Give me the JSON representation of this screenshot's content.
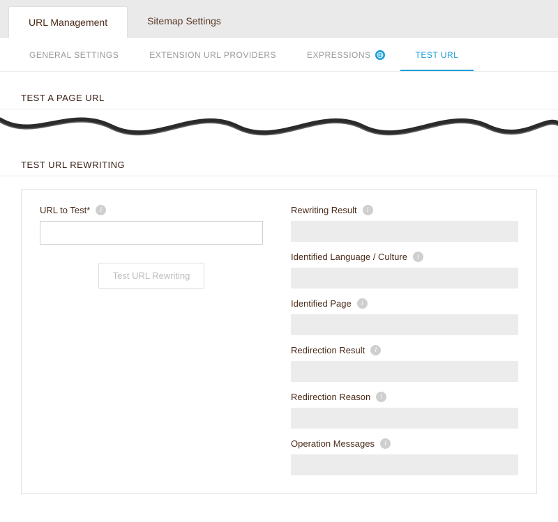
{
  "top_tabs": {
    "url_management": "URL Management",
    "sitemap_settings": "Sitemap Settings"
  },
  "sub_tabs": {
    "general_settings": "GENERAL SETTINGS",
    "extension_url_providers": "EXTENSION URL PROVIDERS",
    "expressions": "EXPRESSIONS",
    "test_url": "TEST URL"
  },
  "sections": {
    "test_page_url": "TEST A PAGE URL",
    "test_url_rewriting": "TEST URL REWRITING"
  },
  "form": {
    "url_to_test_label": "URL to Test*",
    "url_to_test_value": "",
    "test_button": "Test URL Rewriting"
  },
  "results": {
    "rewriting_result": "Rewriting Result",
    "identified_language_culture": "Identified Language / Culture",
    "identified_page": "Identified Page",
    "redirection_result": "Redirection Result",
    "redirection_reason": "Redirection Reason",
    "operation_messages": "Operation Messages"
  }
}
